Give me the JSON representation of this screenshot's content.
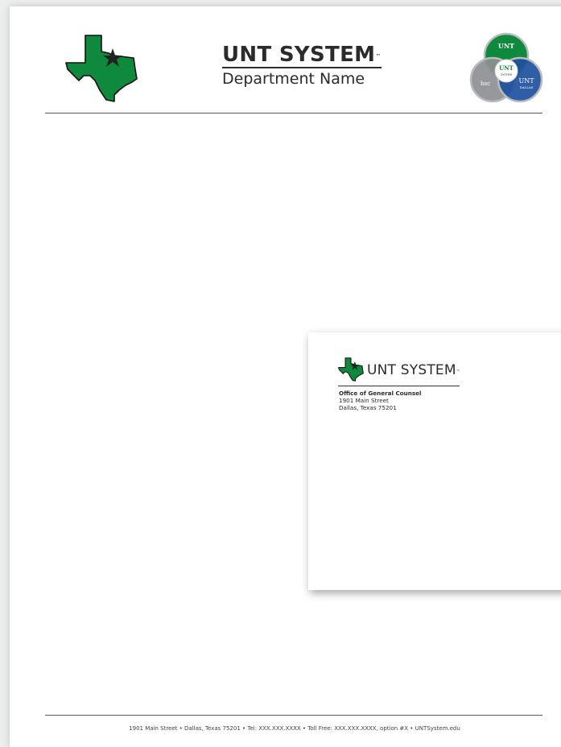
{
  "letterhead": {
    "brand_title": "UNT SYSTEM",
    "trademark": "™",
    "department": "Department Name",
    "footer": "1901 Main Street • Dallas, Texas 75201 • Tel: XXX.XXX.XXXX • Toll Free: XXX.XXX.XXXX, option #X • UNTSystem.edu"
  },
  "venn_logo": {
    "top": "UNT",
    "center_top": "UNT",
    "center_bottom": "SYSTEM",
    "left": "hsc",
    "right_top": "UNT",
    "right_bottom": "DALLAS"
  },
  "envelope": {
    "brand": "UNT SYSTEM",
    "trademark": "™",
    "office": "Office of General Counsel",
    "street": "1901 Main Street",
    "city": "Dallas, Texas 75201"
  },
  "colors": {
    "unt_green": "#0f8a3c",
    "dark_gray": "#2b2b2b",
    "dallas_blue": "#1d4f9e",
    "hsc_gray": "#8d8f92"
  },
  "icons": [
    "texas-star-icon",
    "venn-institutions-icon"
  ]
}
